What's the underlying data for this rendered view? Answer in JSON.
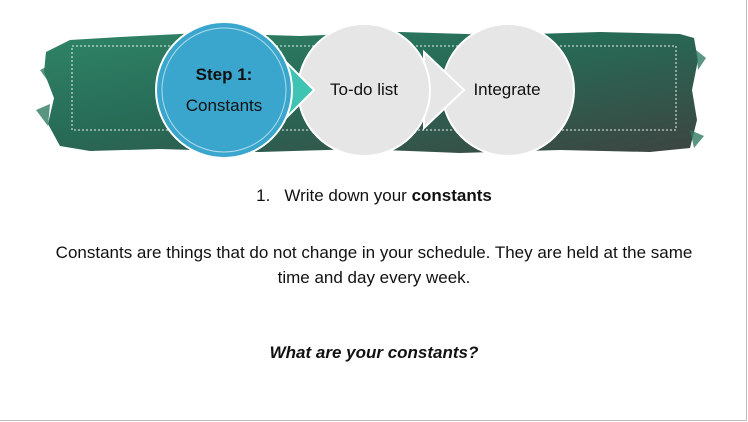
{
  "slide": {
    "process": {
      "steps": [
        {
          "title": "Step 1:",
          "subtitle": "Constants",
          "active": true
        },
        {
          "title": "To-do list",
          "active": false
        },
        {
          "title": "Integrate",
          "active": false
        }
      ]
    },
    "list_item": {
      "number": "1.",
      "text": "Write down your ",
      "bold": "constants"
    },
    "paragraph": "Constants are things that do not change in your schedule. They are held at the same time and day every week.",
    "question": "What are your constants?"
  },
  "colors": {
    "band_dark": "#3e4a44",
    "band_green": "#2e7a62",
    "active_circle": "#3aa6cd",
    "active_arrow": "#3fc4b3",
    "inactive_circle": "#e6e6e6"
  }
}
